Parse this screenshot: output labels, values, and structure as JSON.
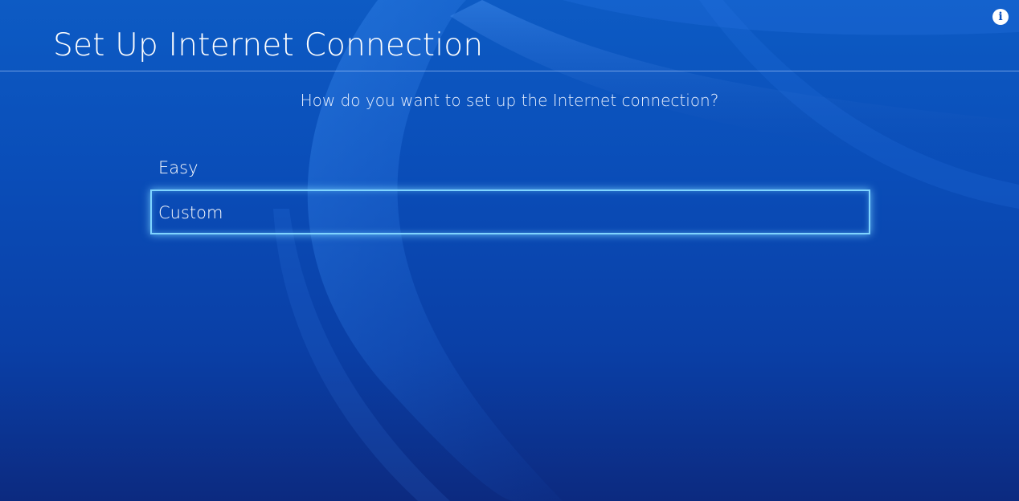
{
  "header": {
    "title": "Set Up Internet Connection",
    "info_icon": "info-icon"
  },
  "main": {
    "question": "How do you want to set up the Internet connection?",
    "options": [
      {
        "label": "Easy",
        "focused": false
      },
      {
        "label": "Custom",
        "focused": true
      }
    ]
  },
  "colors": {
    "background_top": "#0d5bc4",
    "background_bottom": "#0c2a80",
    "focus_border": "#7fd4ff"
  }
}
